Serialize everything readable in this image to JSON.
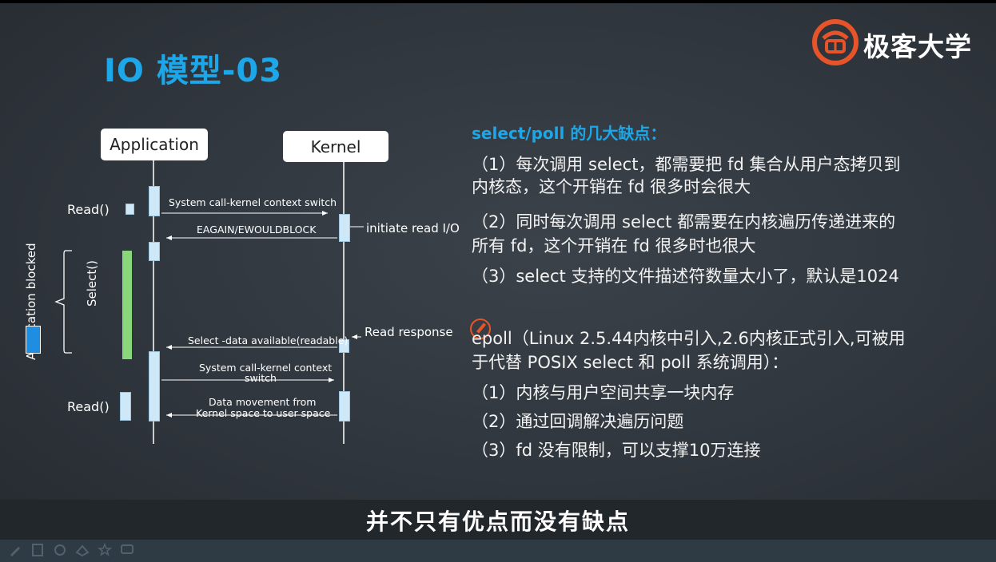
{
  "slide": {
    "title": "IO 模型-03",
    "logo_text": "极客大学"
  },
  "diagram": {
    "application": "Application",
    "kernel": "Kernel",
    "read1": "Read()",
    "read2": "Read()",
    "syscall1": "System call-kernel context switch",
    "eagain": "EAGAIN/EWOULDBLOCK",
    "initiate": "initiate read I/O",
    "blocked": "Application blocked",
    "select": "Select()",
    "read_response": "Read response",
    "select_data": "Select -data available(readable)",
    "syscall2_line1": "System call-kernel context",
    "syscall2_line2": "switch",
    "data_move_line1": "Data movement from",
    "data_move_line2": "Kernel space to user space"
  },
  "right_panel": {
    "heading": "select/poll 的几大缺点：",
    "item1_line1": "（1）每次调用 select，都需要把 fd 集合从用户态拷贝到",
    "item1_line2": "内核态，这个开销在 fd 很多时会很大",
    "item2_line1": "（2）同时每次调用 select 都需要在内核遍历传递进来的",
    "item2_line2": "所有 fd，这个开销在 fd 很多时也很大",
    "item3": "（3）select 支持的文件描述符数量太小了，默认是1024",
    "epoll_line1": "epoll（Linux 2.5.44内核中引入,2.6内核正式引入,可被用",
    "epoll_line2": "于代替 POSIX select 和 poll 系统调用）：",
    "epoll1": "（1）内核与用户空间共享一块内存",
    "epoll2": "（2）通过回调解决遍历问题",
    "epoll3": "（3）fd 没有限制，可以支撑10万连接"
  },
  "subtitle": "并不只有优点而没有缺点",
  "colors": {
    "accent": "#1ea7e8",
    "logo_orange": "#e8542a",
    "blocked_bar": "#8ad67a"
  }
}
